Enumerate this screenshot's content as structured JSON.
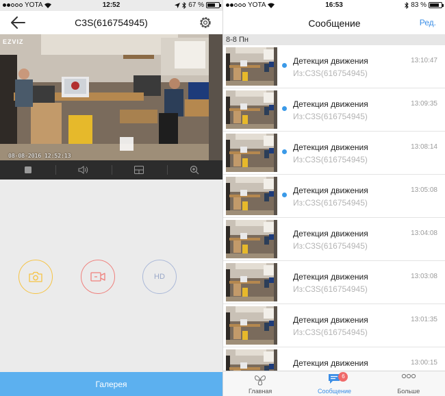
{
  "left": {
    "status": {
      "carrier": "YOTA",
      "time": "12:52",
      "battery": "67 %",
      "battery_level": 0.67
    },
    "nav": {
      "title": "C3S(616754945)"
    },
    "video": {
      "logo": "EZVIZ",
      "timestamp": "08-08-2016 12:52:13"
    },
    "actions": {
      "hd_label": "HD"
    },
    "gallery_label": "Галерея"
  },
  "right": {
    "status": {
      "carrier": "YOTA",
      "time": "16:53",
      "battery": "83 %",
      "battery_level": 0.83
    },
    "nav": {
      "title": "Сообщение",
      "edit": "Ред."
    },
    "date_header": "8-8 Пн",
    "messages": [
      {
        "event": "Детекция движения",
        "source": "Из:C3S(616754945)",
        "time": "13:10:47",
        "unread": true
      },
      {
        "event": "Детекция движения",
        "source": "Из:C3S(616754945)",
        "time": "13:09:35",
        "unread": true
      },
      {
        "event": "Детекция движения",
        "source": "Из:C3S(616754945)",
        "time": "13:08:14",
        "unread": true
      },
      {
        "event": "Детекция движения",
        "source": "Из:C3S(616754945)",
        "time": "13:05:08",
        "unread": true
      },
      {
        "event": "Детекция движения",
        "source": "Из:C3S(616754945)",
        "time": "13:04:08",
        "unread": false
      },
      {
        "event": "Детекция движения",
        "source": "Из:C3S(616754945)",
        "time": "13:03:08",
        "unread": false
      },
      {
        "event": "Детекция движения",
        "source": "Из:C3S(616754945)",
        "time": "13:01:35",
        "unread": false
      },
      {
        "event": "Детекция движения",
        "source": "Из:C3S(616754945)",
        "time": "13:00:15",
        "unread": false
      }
    ],
    "tabs": [
      {
        "label": "Главная",
        "icon": "fan-icon",
        "active": false
      },
      {
        "label": "Сообщение",
        "icon": "message-icon",
        "active": true,
        "badge": "6"
      },
      {
        "label": "Больше",
        "icon": "more-icon",
        "active": false
      }
    ]
  },
  "colors": {
    "accent": "#3b8ee6",
    "gallery_bg": "#5cb0ef",
    "snapshot_ring": "#f6c343",
    "record_ring": "#ef7f7b",
    "hd_ring": "#aab8d8",
    "unread_dot": "#3b9ae8",
    "badge": "#ef6a6a"
  }
}
